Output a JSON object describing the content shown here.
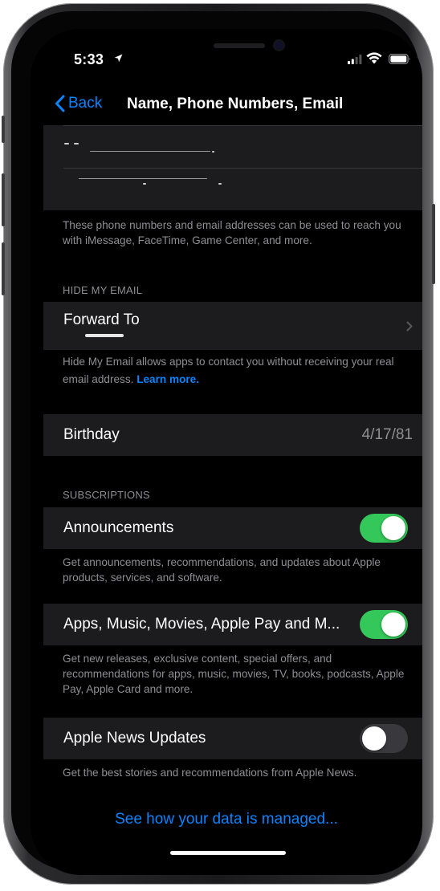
{
  "status_bar": {
    "time": "5:33",
    "location_icon": "location-arrow-icon",
    "signal_icon": "cellular-signal-icon",
    "wifi_icon": "wifi-icon",
    "battery_icon": "battery-icon"
  },
  "nav": {
    "back_label": "Back",
    "back_icon": "chevron-left-icon",
    "title": "Name, Phone Numbers, Email"
  },
  "contact_methods": {
    "footer": "These phone numbers and email addresses can be used to reach you with iMessage, FaceTime, Game Center, and more."
  },
  "hide_my_email": {
    "header": "HIDE MY EMAIL",
    "forward_to_label": "Forward To",
    "footer_text": "Hide My Email allows apps to contact you without receiving your real email address.",
    "footer_link": "Learn more."
  },
  "birthday": {
    "label": "Birthday",
    "value": "4/17/81"
  },
  "subscriptions": {
    "header": "SUBSCRIPTIONS",
    "items": [
      {
        "label": "Announcements",
        "enabled": true,
        "footer": "Get announcements, recommendations, and updates about Apple products, services, and software."
      },
      {
        "label": "Apps, Music, Movies, Apple Pay and M...",
        "enabled": true,
        "footer": "Get new releases, exclusive content, special offers, and recommendations for apps, music, movies, TV, books, podcasts, Apple Pay, Apple Card and more."
      },
      {
        "label": "Apple News Updates",
        "enabled": false,
        "footer": "Get the best stories and recommendations from Apple News."
      }
    ]
  },
  "data_link": "See how your data is managed...",
  "colors": {
    "accent": "#0a84ff",
    "toggle_on": "#34c759",
    "cell_background": "#1c1c1e",
    "secondary_text": "#8e8e93"
  }
}
